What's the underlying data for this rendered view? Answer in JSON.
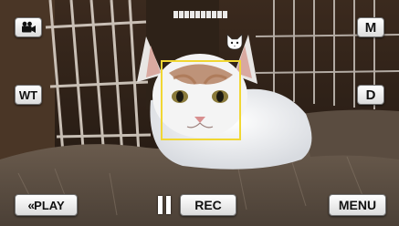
{
  "screen": {
    "top_left": {
      "icon": "video-camera-icon"
    },
    "top_right": {
      "mode_label": "M"
    },
    "left": {
      "zoom_label": "WT"
    },
    "right": {
      "display_label": "D"
    },
    "status": {
      "icon": "pet-face-icon",
      "recording_indicator_icon": "recording-progress-indicator-icon"
    },
    "detection": {
      "face_frame_color": "#f1d733"
    },
    "bottom": {
      "play_chevron": "«",
      "play_label": "PLAY",
      "pause_icon": "pause-icon",
      "rec_label": "REC",
      "menu_label": "MENU"
    }
  }
}
